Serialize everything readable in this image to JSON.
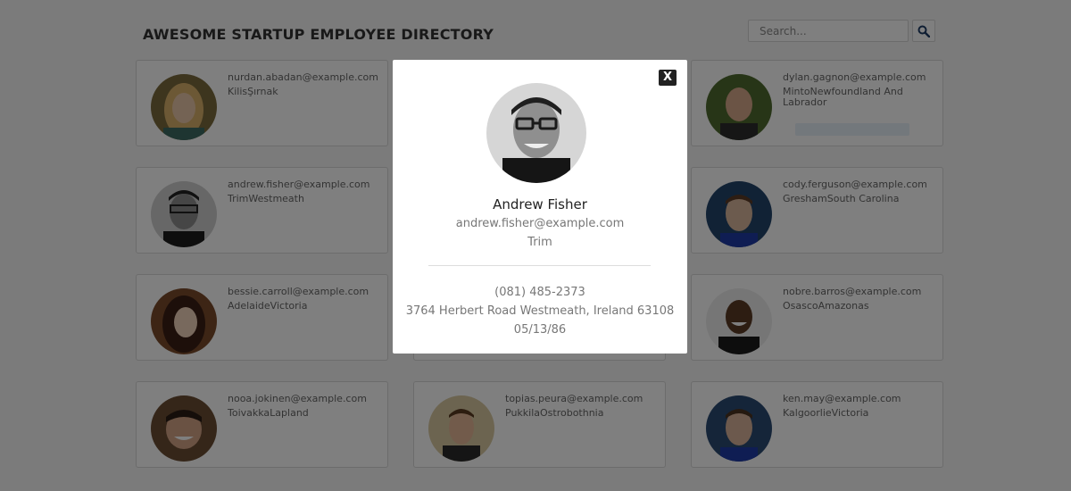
{
  "header": {
    "title": "AWESOME STARTUP EMPLOYEE DIRECTORY",
    "search_placeholder": "Search..."
  },
  "employees": [
    {
      "email": "nurdan.abadan@example.com",
      "location": "KilisŞırnak",
      "avatar": "woman-blonde"
    },
    {
      "email": "",
      "location": "",
      "avatar": ""
    },
    {
      "email": "dylan.gagnon@example.com",
      "location": "MintoNewfoundland And Labrador",
      "avatar": "man-bald"
    },
    {
      "email": "andrew.fisher@example.com",
      "location": "TrimWestmeath",
      "avatar": "man-glasses"
    },
    {
      "email": "",
      "location": "",
      "avatar": ""
    },
    {
      "email": "cody.ferguson@example.com",
      "location": "GreshamSouth Carolina",
      "avatar": "young-man"
    },
    {
      "email": "bessie.carroll@example.com",
      "location": "AdelaideVictoria",
      "avatar": "woman-dark-hair"
    },
    {
      "email": "",
      "location": "",
      "avatar": ""
    },
    {
      "email": "nobre.barros@example.com",
      "location": "OsascoAmazonas",
      "avatar": "man-smiling"
    },
    {
      "email": "nooa.jokinen@example.com",
      "location": "ToivakkaLapland",
      "avatar": "man-smiling-2"
    },
    {
      "email": "topias.peura@example.com",
      "location": "PukkilaOstrobothnia",
      "avatar": "young-man-2"
    },
    {
      "email": "ken.may@example.com",
      "location": "KalgoorlieVictoria",
      "avatar": "young-man-3"
    }
  ],
  "modal": {
    "close_label": "X",
    "name": "Andrew Fisher",
    "email": "andrew.fisher@example.com",
    "city": "Trim",
    "phone": "(081) 485-2373",
    "address": "3764 Herbert Road Westmeath, Ireland 63108",
    "dob": "05/13/86",
    "avatar": "man-glasses"
  },
  "colors": {
    "overlay": "#000000",
    "close_button": "#222222",
    "card_border": "#d8d8d8"
  }
}
